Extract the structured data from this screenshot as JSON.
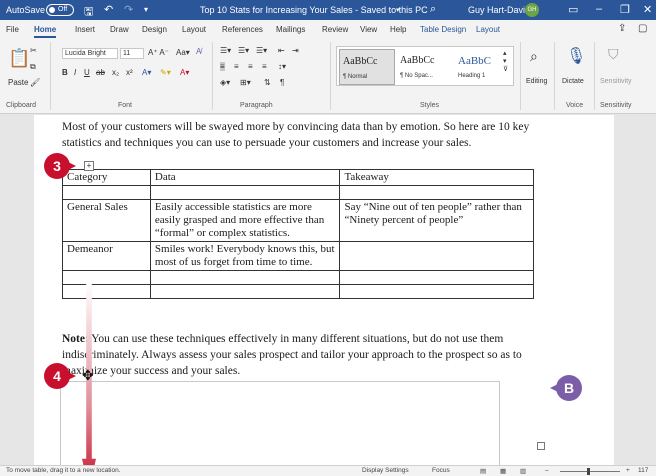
{
  "titlebar": {
    "autosave_label": "AutoSave",
    "autosave_state": "Off",
    "doc_title": "Top 10 Stats for Increasing Your Sales - Saved to this PC",
    "user_name": "Guy Hart-Davis",
    "user_initials": "GH"
  },
  "tabs": [
    "File",
    "Home",
    "Insert",
    "Draw",
    "Design",
    "Layout",
    "References",
    "Mailings",
    "Review",
    "View",
    "Help",
    "Table Design",
    "Layout"
  ],
  "ribbon": {
    "font_name": "Lucida Bright",
    "font_size": "11",
    "paste_label": "Paste",
    "groups": {
      "clipboard": "Clipboard",
      "font": "Font",
      "paragraph": "Paragraph",
      "styles": "Styles",
      "voice": "Voice",
      "sensitivity": "Sensitivity"
    },
    "styles": [
      {
        "sample": "AaBbCc",
        "name": "¶ Normal"
      },
      {
        "sample": "AaBbCc",
        "name": "¶ No Spac..."
      },
      {
        "sample": "AaBbC",
        "name": "Heading 1"
      }
    ],
    "editing_label": "Editing",
    "dictate_label": "Dictate",
    "sensitivity_label": "Sensitivity"
  },
  "document": {
    "intro": "Most of your customers will be swayed more by convincing data than by emotion. So here are 10 key statistics and techniques you can use to persuade your customers and increase your sales.",
    "table": {
      "headers": [
        "Category",
        "Data",
        "Takeaway"
      ],
      "rows": [
        [
          "",
          "",
          ""
        ],
        [
          "General Sales",
          "Easily accessible statistics are more easily grasped and more effective than “formal” or complex statistics.",
          "Say “Nine out of ten people” rather than “Ninety percent of people”"
        ],
        [
          "Demeanor",
          "Smiles work! Everybody knows this, but most of us forget from time to time.",
          ""
        ],
        [
          "",
          "",
          ""
        ],
        [
          "",
          "",
          ""
        ]
      ]
    },
    "note_label": "Note:",
    "note_text": " You can use these techniques effectively in many different situations, but do not use them indiscriminately. Always assess your sales prospect and tailor your approach to the prospect so as to maximize your success and your sales."
  },
  "callouts": {
    "step3": "3",
    "step4": "4",
    "stepB": "B"
  },
  "statusbar": {
    "message": "To move table, drag it to a new location.",
    "display_settings": "Display Settings",
    "focus": "Focus",
    "zoom": "117"
  },
  "colors": {
    "word_blue": "#2b579a",
    "callout_red": "#c8102e",
    "callout_purple": "#7b5ea7"
  }
}
